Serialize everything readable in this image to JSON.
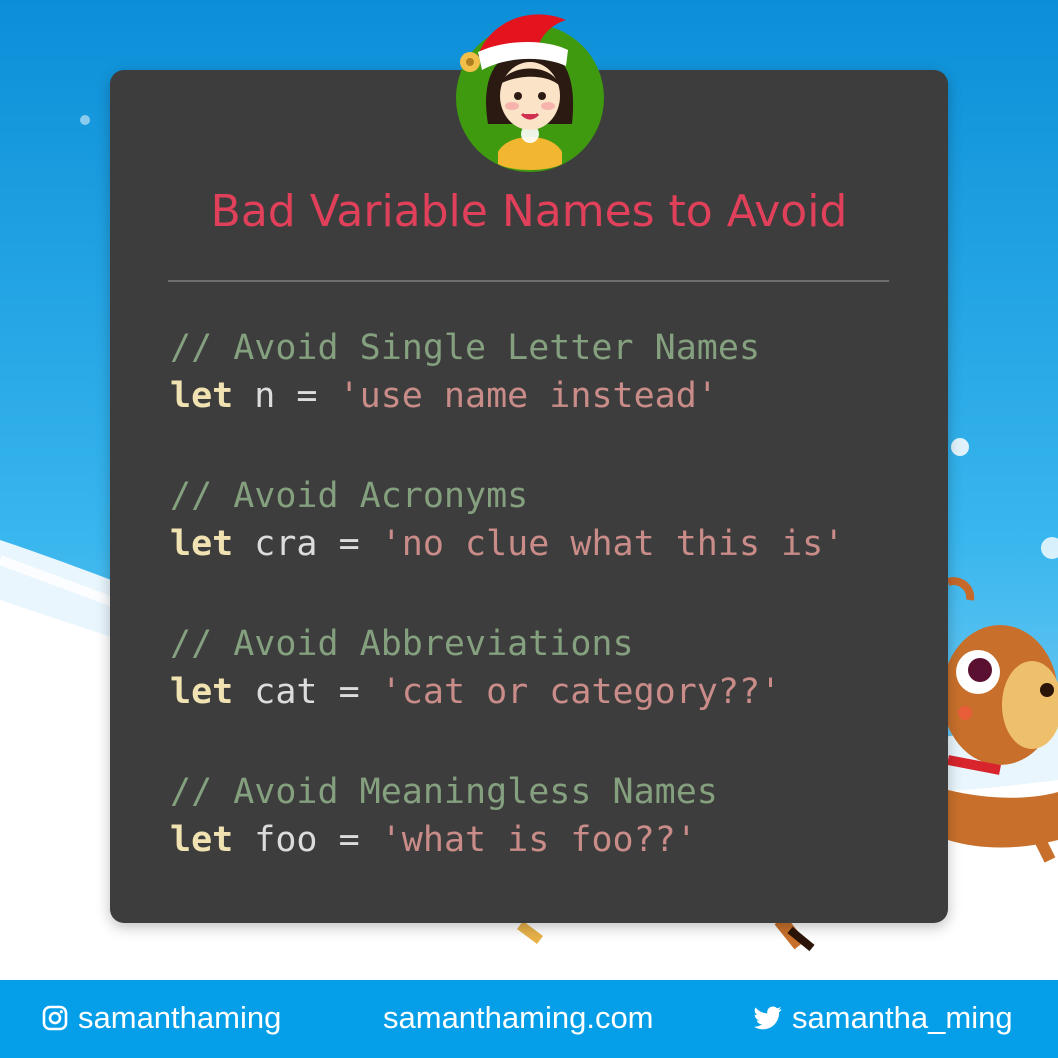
{
  "title": "Bad Variable Names to Avoid",
  "code_blocks": [
    {
      "comment": "// Avoid Single Letter Names",
      "keyword": "let",
      "code": " n = ",
      "string": "'use name instead'"
    },
    {
      "comment": "// Avoid Acronyms",
      "keyword": "let",
      "code": " cra = ",
      "string": "'no clue what this is'"
    },
    {
      "comment": "// Avoid Abbreviations",
      "keyword": "let",
      "code": " cat = ",
      "string": "'cat or category??'"
    },
    {
      "comment": "// Avoid Meaningless Names",
      "keyword": "let",
      "code": " foo = ",
      "string": "'what is foo??'"
    }
  ],
  "footer": {
    "instagram": "samanthaming",
    "website": "samanthaming.com",
    "twitter": "samantha_ming"
  },
  "colors": {
    "title": "#e0405a",
    "card": "#3d3d3d",
    "comment": "#84a07e",
    "keyword": "#f1e2b1",
    "string": "#c98c88",
    "footer": "#049fe8"
  },
  "icons": [
    "instagram-icon",
    "twitter-icon",
    "avatar-santa-hat",
    "reindeer-illustration",
    "snowflake-icon"
  ]
}
